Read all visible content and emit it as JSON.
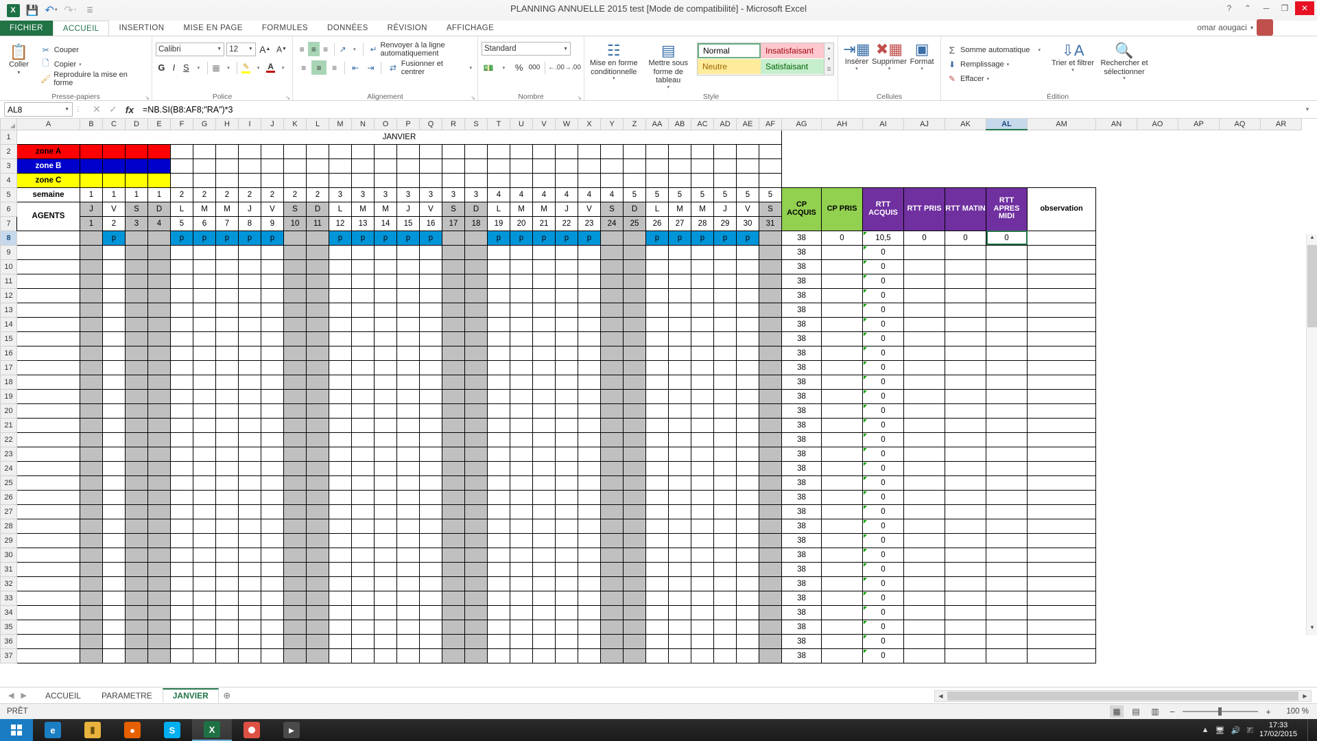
{
  "titlebar": {
    "app_title": "PLANNING ANNUELLE 2015 test  [Mode de compatibilité] - Microsoft Excel",
    "logo_text": "X",
    "qat": [
      {
        "name": "save",
        "glyph": "💾"
      },
      {
        "name": "undo",
        "glyph": "↶"
      },
      {
        "name": "redo",
        "glyph": "↷"
      },
      {
        "name": "customize",
        "glyph": "≡"
      }
    ],
    "help": "?",
    "ribbon_options": "⌃",
    "minimize": "─",
    "maximize": "❐",
    "close": "✕",
    "user": "omar aougaci",
    "user_caret": "▾"
  },
  "tabs": [
    {
      "label": "FICHIER",
      "kind": "file"
    },
    {
      "label": "ACCUEIL",
      "kind": "active"
    },
    {
      "label": "INSERTION",
      "kind": "normal"
    },
    {
      "label": "MISE EN PAGE",
      "kind": "normal"
    },
    {
      "label": "FORMULES",
      "kind": "normal"
    },
    {
      "label": "DONNÉES",
      "kind": "normal"
    },
    {
      "label": "RÉVISION",
      "kind": "normal"
    },
    {
      "label": "AFFICHAGE",
      "kind": "normal"
    }
  ],
  "ribbon": {
    "clipboard": {
      "group_label": "Presse-papiers",
      "paste": "Coller",
      "paste_caret": "▾",
      "cut": "Couper",
      "copy": "Copier",
      "copy_caret": "▾",
      "format_painter": "Reproduire la mise en forme",
      "dialog_launcher": "↘"
    },
    "font": {
      "group_label": "Police",
      "family": "Calibri",
      "size": "12",
      "grow": "A▴",
      "shrink": "A▾",
      "bold": "G",
      "italic": "I",
      "underline": "S",
      "underline_caret": "▾",
      "borders": "▦",
      "borders_caret": "▾",
      "fill": "✐",
      "fill_caret": "▾",
      "color": "A",
      "color_caret": "▾",
      "dialog_launcher": "↘"
    },
    "alignment": {
      "group_label": "Alignement",
      "align_top": "≡",
      "align_middle": "≡",
      "align_bottom": "≡",
      "orientation": "↗",
      "orientation_caret": "▾",
      "align_left": "≡",
      "align_center": "≡",
      "align_right": "≡",
      "indent_dec": "⇤",
      "indent_inc": "⇥",
      "wrap_text": "Renvoyer à la ligne automatiquement",
      "merge": "Fusionner et centrer",
      "merge_caret": "▾",
      "dialog_launcher": "↘"
    },
    "number": {
      "group_label": "Nombre",
      "format": "Standard",
      "currency": "¤",
      "currency_caret": "▾",
      "percent": "%",
      "thousands": "000",
      "dec_inc": "₊₀₀",
      "dec_dec": "₋₀₀",
      "dialog_launcher": "↘"
    },
    "styles": {
      "group_label": "Style",
      "conditional": "Mise en forme conditionnelle",
      "conditional_caret": "▾",
      "as_table": "Mettre sous forme de tableau",
      "as_table_caret": "▾",
      "cell_styles": [
        {
          "label": "Normal",
          "cls": "sc-normal"
        },
        {
          "label": "Insatisfaisant",
          "cls": "sc-insat"
        },
        {
          "label": "Neutre",
          "cls": "sc-neutre"
        },
        {
          "label": "Satisfaisant",
          "cls": "sc-satis"
        }
      ],
      "scroll_up": "▴",
      "scroll_down": "▾",
      "scroll_more": "☰"
    },
    "cells": {
      "group_label": "Cellules",
      "insert": "Insérer",
      "delete": "Supprimer",
      "format": "Format",
      "caret": "▾"
    },
    "editing": {
      "group_label": "Édition",
      "autosum": "Somme automatique",
      "autosum_caret": "▾",
      "fill": "Remplissage",
      "fill_caret": "▾",
      "clear": "Effacer",
      "clear_caret": "▾",
      "sort_filter": "Trier et filtrer",
      "sort_filter_caret": "▾",
      "find_select": "Rechercher et sélectionner",
      "find_select_caret": "▾"
    }
  },
  "formula_bar": {
    "name_box": "AL8",
    "name_caret": "▾",
    "cancel": "✕",
    "confirm": "✓",
    "function": "fx",
    "formula": "=NB.SI(B8:AF8;\"RA\")*3",
    "expand": "▾"
  },
  "grid": {
    "columns": [
      "A",
      "B",
      "C",
      "D",
      "E",
      "F",
      "G",
      "H",
      "I",
      "J",
      "K",
      "L",
      "M",
      "N",
      "O",
      "P",
      "Q",
      "R",
      "S",
      "T",
      "U",
      "V",
      "W",
      "X",
      "Y",
      "Z",
      "AA",
      "AB",
      "AC",
      "AD",
      "AE",
      "AF",
      "AG",
      "AH",
      "AI",
      "AJ",
      "AK",
      "AL",
      "AM",
      "AN",
      "AO",
      "AP",
      "AQ",
      "AR"
    ],
    "selected_column": "AL",
    "selected_row": 8,
    "row_numbers": [
      1,
      2,
      3,
      4,
      5,
      6,
      7,
      8,
      9,
      10,
      11,
      12,
      13,
      14,
      15,
      16,
      17,
      18,
      19,
      20,
      21,
      22,
      23,
      24,
      25,
      26,
      27,
      28,
      29,
      30,
      31,
      32,
      33,
      34,
      35,
      36,
      37
    ],
    "month_title": "JANVIER",
    "zones": [
      {
        "label": "zone A",
        "color": "#ff0000"
      },
      {
        "label": "zone B",
        "color": "#0000cd"
      },
      {
        "label": "zone C",
        "color": "#ffff00"
      }
    ],
    "row_labels": {
      "semaine": "semaine",
      "agents": "AGENTS"
    },
    "weeks": [
      1,
      1,
      1,
      1,
      2,
      2,
      2,
      2,
      2,
      2,
      2,
      3,
      3,
      3,
      3,
      3,
      3,
      3,
      4,
      4,
      4,
      4,
      4,
      4,
      5,
      5,
      5,
      5,
      5,
      5,
      5
    ],
    "daynames": [
      "J",
      "V",
      "S",
      "D",
      "L",
      "M",
      "M",
      "J",
      "V",
      "S",
      "D",
      "L",
      "M",
      "M",
      "J",
      "V",
      "S",
      "D",
      "L",
      "M",
      "M",
      "J",
      "V",
      "S",
      "D",
      "L",
      "M",
      "M",
      "J",
      "V",
      "S"
    ],
    "daynums": [
      1,
      2,
      3,
      4,
      5,
      6,
      7,
      8,
      9,
      10,
      11,
      12,
      13,
      14,
      15,
      16,
      17,
      18,
      19,
      20,
      21,
      22,
      23,
      24,
      25,
      26,
      27,
      28,
      29,
      30,
      31
    ],
    "weekend_indices": [
      0,
      2,
      3,
      9,
      10,
      16,
      17,
      23,
      24,
      30
    ],
    "row8_p_indices": [
      1,
      4,
      5,
      6,
      7,
      8,
      11,
      12,
      13,
      14,
      15,
      18,
      19,
      20,
      21,
      22,
      25,
      26,
      27,
      28,
      29
    ],
    "row8_blue_indices": [
      1,
      4,
      5,
      6,
      7,
      8,
      11,
      12,
      13,
      14,
      15,
      18,
      19,
      20,
      21,
      22,
      25,
      26,
      27,
      28,
      29
    ],
    "p_mark": "p",
    "right_headers": [
      {
        "label": "CP ACQUIS",
        "color": "green"
      },
      {
        "label": "CP PRIS",
        "color": "green"
      },
      {
        "label": "RTT ACQUIS",
        "color": "purple"
      },
      {
        "label": "RTT PRIS",
        "color": "purple"
      },
      {
        "label": "RTT MATIN",
        "color": "purple"
      },
      {
        "label": "RTT APRES MIDI",
        "color": "purple"
      },
      {
        "label": "observation",
        "color": "white"
      }
    ],
    "right_rows": [
      {
        "cp_acquis": "38",
        "cp_pris": "0",
        "rtt_acquis": "10,5",
        "rtt_pris": "0",
        "rtt_matin": "0",
        "rtt_apres": "0",
        "observation": ""
      },
      {
        "cp_acquis": "38",
        "cp_pris": "",
        "rtt_acquis": "0",
        "rtt_pris": "",
        "rtt_matin": "",
        "rtt_apres": "",
        "observation": ""
      },
      {
        "cp_acquis": "38",
        "cp_pris": "",
        "rtt_acquis": "0",
        "rtt_pris": "",
        "rtt_matin": "",
        "rtt_apres": "",
        "observation": ""
      },
      {
        "cp_acquis": "38",
        "cp_pris": "",
        "rtt_acquis": "0",
        "rtt_pris": "",
        "rtt_matin": "",
        "rtt_apres": "",
        "observation": ""
      },
      {
        "cp_acquis": "38",
        "cp_pris": "",
        "rtt_acquis": "0",
        "rtt_pris": "",
        "rtt_matin": "",
        "rtt_apres": "",
        "observation": ""
      },
      {
        "cp_acquis": "38",
        "cp_pris": "",
        "rtt_acquis": "0",
        "rtt_pris": "",
        "rtt_matin": "",
        "rtt_apres": "",
        "observation": ""
      },
      {
        "cp_acquis": "38",
        "cp_pris": "",
        "rtt_acquis": "0",
        "rtt_pris": "",
        "rtt_matin": "",
        "rtt_apres": "",
        "observation": ""
      },
      {
        "cp_acquis": "38",
        "cp_pris": "",
        "rtt_acquis": "0",
        "rtt_pris": "",
        "rtt_matin": "",
        "rtt_apres": "",
        "observation": ""
      },
      {
        "cp_acquis": "38",
        "cp_pris": "",
        "rtt_acquis": "0",
        "rtt_pris": "",
        "rtt_matin": "",
        "rtt_apres": "",
        "observation": ""
      },
      {
        "cp_acquis": "38",
        "cp_pris": "",
        "rtt_acquis": "0",
        "rtt_pris": "",
        "rtt_matin": "",
        "rtt_apres": "",
        "observation": ""
      },
      {
        "cp_acquis": "38",
        "cp_pris": "",
        "rtt_acquis": "0",
        "rtt_pris": "",
        "rtt_matin": "",
        "rtt_apres": "",
        "observation": ""
      },
      {
        "cp_acquis": "38",
        "cp_pris": "",
        "rtt_acquis": "0",
        "rtt_pris": "",
        "rtt_matin": "",
        "rtt_apres": "",
        "observation": ""
      },
      {
        "cp_acquis": "38",
        "cp_pris": "",
        "rtt_acquis": "0",
        "rtt_pris": "",
        "rtt_matin": "",
        "rtt_apres": "",
        "observation": ""
      },
      {
        "cp_acquis": "38",
        "cp_pris": "",
        "rtt_acquis": "0",
        "rtt_pris": "",
        "rtt_matin": "",
        "rtt_apres": "",
        "observation": ""
      },
      {
        "cp_acquis": "38",
        "cp_pris": "",
        "rtt_acquis": "0",
        "rtt_pris": "",
        "rtt_matin": "",
        "rtt_apres": "",
        "observation": ""
      },
      {
        "cp_acquis": "38",
        "cp_pris": "",
        "rtt_acquis": "0",
        "rtt_pris": "",
        "rtt_matin": "",
        "rtt_apres": "",
        "observation": ""
      },
      {
        "cp_acquis": "38",
        "cp_pris": "",
        "rtt_acquis": "0",
        "rtt_pris": "",
        "rtt_matin": "",
        "rtt_apres": "",
        "observation": ""
      },
      {
        "cp_acquis": "38",
        "cp_pris": "",
        "rtt_acquis": "0",
        "rtt_pris": "",
        "rtt_matin": "",
        "rtt_apres": "",
        "observation": ""
      },
      {
        "cp_acquis": "38",
        "cp_pris": "",
        "rtt_acquis": "0",
        "rtt_pris": "",
        "rtt_matin": "",
        "rtt_apres": "",
        "observation": ""
      },
      {
        "cp_acquis": "38",
        "cp_pris": "",
        "rtt_acquis": "0",
        "rtt_pris": "",
        "rtt_matin": "",
        "rtt_apres": "",
        "observation": ""
      },
      {
        "cp_acquis": "38",
        "cp_pris": "",
        "rtt_acquis": "0",
        "rtt_pris": "",
        "rtt_matin": "",
        "rtt_apres": "",
        "observation": ""
      },
      {
        "cp_acquis": "38",
        "cp_pris": "",
        "rtt_acquis": "0",
        "rtt_pris": "",
        "rtt_matin": "",
        "rtt_apres": "",
        "observation": ""
      },
      {
        "cp_acquis": "38",
        "cp_pris": "",
        "rtt_acquis": "0",
        "rtt_pris": "",
        "rtt_matin": "",
        "rtt_apres": "",
        "observation": ""
      },
      {
        "cp_acquis": "38",
        "cp_pris": "",
        "rtt_acquis": "0",
        "rtt_pris": "",
        "rtt_matin": "",
        "rtt_apres": "",
        "observation": ""
      },
      {
        "cp_acquis": "38",
        "cp_pris": "",
        "rtt_acquis": "0",
        "rtt_pris": "",
        "rtt_matin": "",
        "rtt_apres": "",
        "observation": ""
      },
      {
        "cp_acquis": "38",
        "cp_pris": "",
        "rtt_acquis": "0",
        "rtt_pris": "",
        "rtt_matin": "",
        "rtt_apres": "",
        "observation": ""
      },
      {
        "cp_acquis": "38",
        "cp_pris": "",
        "rtt_acquis": "0",
        "rtt_pris": "",
        "rtt_matin": "",
        "rtt_apres": "",
        "observation": ""
      },
      {
        "cp_acquis": "38",
        "cp_pris": "",
        "rtt_acquis": "0",
        "rtt_pris": "",
        "rtt_matin": "",
        "rtt_apres": "",
        "observation": ""
      },
      {
        "cp_acquis": "38",
        "cp_pris": "",
        "rtt_acquis": "0",
        "rtt_pris": "",
        "rtt_matin": "",
        "rtt_apres": "",
        "observation": ""
      },
      {
        "cp_acquis": "38",
        "cp_pris": "",
        "rtt_acquis": "0",
        "rtt_pris": "",
        "rtt_matin": "",
        "rtt_apres": "",
        "observation": ""
      }
    ]
  },
  "sheet_tabs": {
    "nav": [
      "◀",
      "▶"
    ],
    "tabs": [
      {
        "label": "ACCUEIL",
        "active": false
      },
      {
        "label": "PARAMETRE",
        "active": false
      },
      {
        "label": "JANVIER",
        "active": true
      }
    ],
    "add": "⊕"
  },
  "scrollbars": {
    "left_arrow": "◀",
    "right_arrow": "▶",
    "up_arrow": "▲",
    "down_arrow": "▼"
  },
  "status_bar": {
    "state": "PRÊT",
    "views": [
      {
        "name": "normal-view",
        "glyph": "▦",
        "active": true
      },
      {
        "name": "page-layout-view",
        "glyph": "▤",
        "active": false
      },
      {
        "name": "page-break-view",
        "glyph": "▥",
        "active": false
      }
    ],
    "zoom_out": "−",
    "zoom_in": "+",
    "zoom_level": "100 %"
  },
  "taskbar": {
    "items": [
      {
        "name": "internet-explorer",
        "glyph": "e",
        "color": "#1b7ec2"
      },
      {
        "name": "file-explorer",
        "glyph": "📁",
        "color": "#e9b23c"
      },
      {
        "name": "firefox",
        "glyph": "🦊",
        "color": "#e66000"
      },
      {
        "name": "skype",
        "glyph": "S",
        "color": "#00aff0"
      },
      {
        "name": "excel",
        "glyph": "X",
        "color": "#1e7145"
      },
      {
        "name": "chrome",
        "glyph": "●",
        "color": "#dd5144"
      },
      {
        "name": "media-player",
        "glyph": "▶",
        "color": "#555555"
      }
    ],
    "tray": [
      "▲",
      "🖥",
      "🔊",
      "🇫"
    ],
    "time": "17:33",
    "date": "17/02/2015"
  }
}
